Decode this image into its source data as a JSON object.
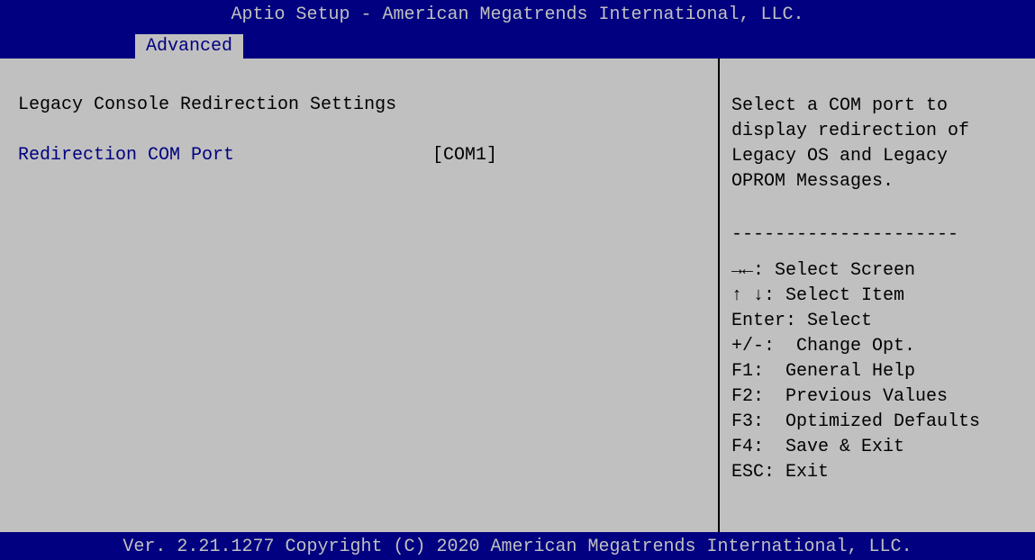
{
  "header": {
    "title": "Aptio Setup - American Megatrends International, LLC."
  },
  "tabs": [
    {
      "label": "Advanced"
    }
  ],
  "main": {
    "section_title": "Legacy Console Redirection Settings",
    "settings": [
      {
        "label": "Redirection COM Port",
        "value": "[COM1]"
      }
    ]
  },
  "help": {
    "description_lines": [
      "Select a COM port to",
      "display redirection of",
      "Legacy OS and Legacy",
      "OPROM Messages."
    ],
    "separator": "---------------------",
    "keys": [
      "→←: Select Screen",
      "↑ ↓: Select Item",
      "Enter: Select",
      "+/-:  Change Opt.",
      "F1:  General Help",
      "F2:  Previous Values",
      "F3:  Optimized Defaults",
      "F4:  Save & Exit",
      "ESC: Exit"
    ]
  },
  "footer": {
    "text": "Ver. 2.21.1277 Copyright (C) 2020 American Megatrends International, LLC."
  },
  "colors": {
    "background": "#c0c0c0",
    "bar": "#000080",
    "accent_text": "#000080",
    "text": "#000000"
  }
}
